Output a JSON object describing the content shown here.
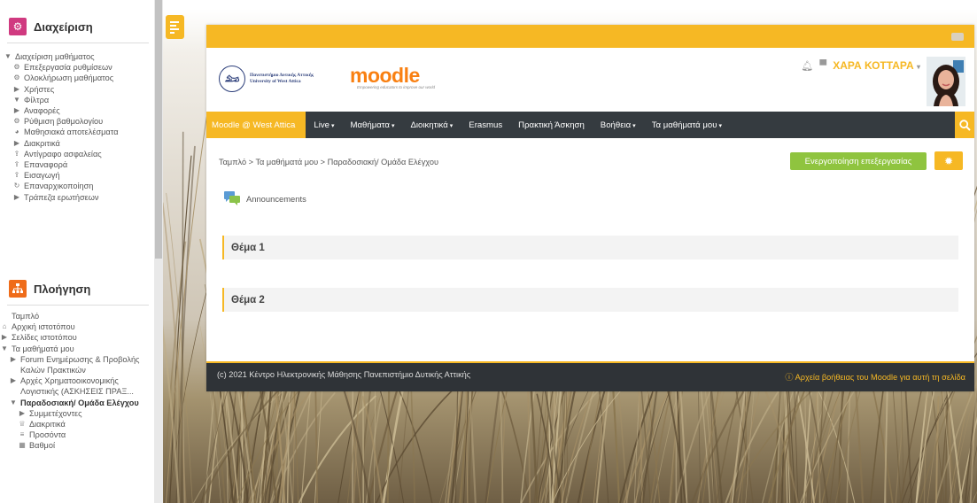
{
  "sidebar": {
    "admin": {
      "title": "Διαχείριση",
      "items": [
        {
          "icon": "caret-down",
          "label": "Διαχείριση μαθήματος",
          "indent": 0,
          "bold": false
        },
        {
          "icon": "gear",
          "label": "Επεξεργασία ρυθμίσεων",
          "indent": 1,
          "bold": false
        },
        {
          "icon": "gear",
          "label": "Ολοκλήρωση μαθήματος",
          "indent": 1,
          "bold": false
        },
        {
          "icon": "caret-right",
          "label": "Χρήστες",
          "indent": 1,
          "bold": false
        },
        {
          "icon": "filter",
          "label": "Φίλτρα",
          "indent": 1,
          "bold": false
        },
        {
          "icon": "caret-right",
          "label": "Αναφορές",
          "indent": 1,
          "bold": false
        },
        {
          "icon": "gear",
          "label": "Ρύθμιση βαθμολογίου",
          "indent": 1,
          "bold": false
        },
        {
          "icon": "pie",
          "label": "Μαθησιακά αποτελέσματα",
          "indent": 1,
          "bold": false
        },
        {
          "icon": "caret-right",
          "label": "Διακριτικά",
          "indent": 1,
          "bold": false
        },
        {
          "icon": "upload",
          "label": "Αντίγραφο ασφαλείας",
          "indent": 1,
          "bold": false
        },
        {
          "icon": "upload",
          "label": "Επαναφορά",
          "indent": 1,
          "bold": false
        },
        {
          "icon": "upload",
          "label": "Εισαγωγή",
          "indent": 1,
          "bold": false
        },
        {
          "icon": "refresh",
          "label": "Επαναρχικοποίηση",
          "indent": 1,
          "bold": false
        },
        {
          "icon": "caret-right",
          "label": "Τράπεζα ερωτήσεων",
          "indent": 1,
          "bold": false
        }
      ]
    },
    "nav": {
      "title": "Πλοήγηση",
      "items": [
        {
          "icon": "",
          "label": "Ταμπλό",
          "indent": 0,
          "bold": false
        },
        {
          "icon": "home",
          "label": "Αρχική ιστοτόπου",
          "indent": 0,
          "bold": false
        },
        {
          "icon": "caret-right",
          "label": "Σελίδες ιστοτόπου",
          "indent": 0,
          "bold": false
        },
        {
          "icon": "caret-down",
          "label": "Τα μαθήματά μου",
          "indent": 0,
          "bold": false
        },
        {
          "icon": "caret-right",
          "label": "Forum Ενημέρωσης & Προβολής Καλών Πρακτικών",
          "indent": 1,
          "bold": false
        },
        {
          "icon": "caret-right",
          "label": "Αρχές Χρηματοοικονομικής Λογιστικής (ΑΣΚΗΣΕΙΣ ΠΡΑΞ...",
          "indent": 1,
          "bold": false
        },
        {
          "icon": "caret-down",
          "label": "Παραδοσιακή/ Ομάδα Ελέγχου",
          "indent": 1,
          "bold": true
        },
        {
          "icon": "caret-right",
          "label": "Συμμετέχοντες",
          "indent": 2,
          "bold": false
        },
        {
          "icon": "trophy",
          "label": "Διακριτικά",
          "indent": 2,
          "bold": false
        },
        {
          "icon": "tasks",
          "label": "Προσόντα",
          "indent": 2,
          "bold": false
        },
        {
          "icon": "table",
          "label": "Βαθμοί",
          "indent": 2,
          "bold": false
        }
      ]
    }
  },
  "topbar": {},
  "header": {
    "university": {
      "line1": "Πανεπιστήμιο Δυτικής Αττικής",
      "line2": "University of West Attica"
    },
    "moodle": {
      "word_main": "moodle",
      "tagline": "Empowering educators to improve our world"
    },
    "user_name": "ΧΑΡΑ ΚΟΤΤΑΡΑ"
  },
  "navbar": {
    "home": "Moodle @ West Attica",
    "items": [
      {
        "label": "Live",
        "dropdown": true
      },
      {
        "label": "Μαθήματα",
        "dropdown": true
      },
      {
        "label": "Διοικητικά",
        "dropdown": true
      },
      {
        "label": "Erasmus",
        "dropdown": false
      },
      {
        "label": "Πρακτική Άσκηση",
        "dropdown": false
      },
      {
        "label": "Βοήθεια",
        "dropdown": true
      },
      {
        "label": "Τα μαθήματά μου",
        "dropdown": true
      }
    ]
  },
  "breadcrumb": [
    "Ταμπλό",
    "Τα μαθήματά μου",
    "Παραδοσιακή/ Ομάδα Ελέγχου"
  ],
  "breadcrumb_sep": " > ",
  "edit_button": "Ενεργοποίηση επεξεργασίας",
  "announcements": "Announcements",
  "topics": [
    "Θέμα 1",
    "Θέμα 2"
  ],
  "footer": {
    "left": "(c) 2021 Κέντρο Ηλεκτρονικής Μάθησης Πανεπιστήμιο Δυτικής Αττικής",
    "right": "ⓘ Αρχεία βοήθειας του Moodle για αυτή τη σελίδα"
  },
  "colors": {
    "accent": "#f6b824",
    "navbar": "#353b40",
    "edit": "#8fc43f",
    "admin_block": "#d03a80",
    "nav_block": "#ef6c1a"
  }
}
